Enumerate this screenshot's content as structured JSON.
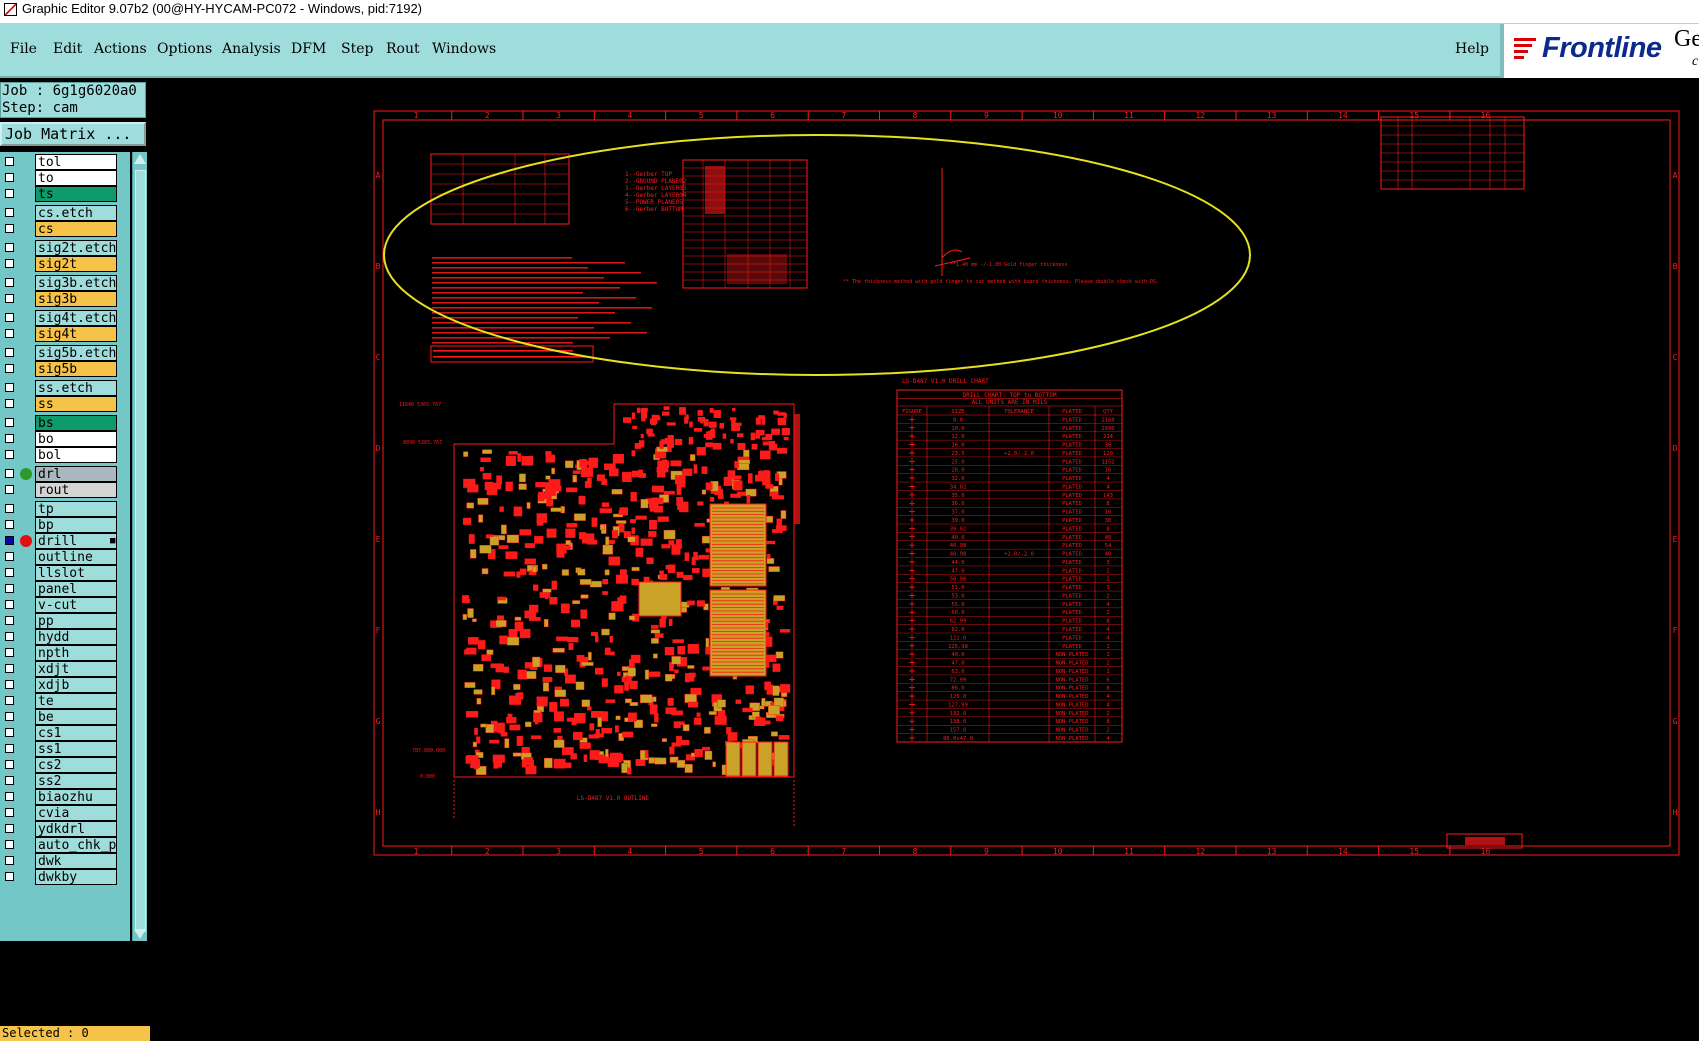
{
  "window": {
    "title": "Graphic Editor 9.07b2 (00@HY-HYCAM-PC072 - Windows, pid:7192)"
  },
  "menu": {
    "items": [
      "File",
      "Edit",
      "Actions",
      "Options",
      "Analysis",
      "DFM",
      "Step",
      "Rout",
      "Windows"
    ],
    "help": "Help"
  },
  "logo": {
    "brand": "Frontline",
    "ge": "Ge",
    "sub": "c"
  },
  "job": {
    "job_line": "Job : 6g1g6020a0",
    "step_line": "Step: cam",
    "matrix_button": "Job Matrix ..."
  },
  "layers": [
    {
      "name": "tol",
      "color": "#ffffff"
    },
    {
      "name": "to",
      "color": "#ffffff"
    },
    {
      "name": "ts",
      "color": "#0f9a6c"
    },
    {
      "name": "cs.etch",
      "color": "#9fdcdc"
    },
    {
      "name": "cs",
      "color": "#f5c24a"
    },
    {
      "name": "sig2t.etch",
      "color": "#9fdcdc"
    },
    {
      "name": "sig2t",
      "color": "#f5c24a"
    },
    {
      "name": "sig3b.etch",
      "color": "#9fdcdc"
    },
    {
      "name": "sig3b",
      "color": "#f5c24a"
    },
    {
      "name": "sig4t.etch",
      "color": "#9fdcdc"
    },
    {
      "name": "sig4t",
      "color": "#f5c24a"
    },
    {
      "name": "sig5b.etch",
      "color": "#9fdcdc"
    },
    {
      "name": "sig5b",
      "color": "#f5c24a"
    },
    {
      "name": "ss.etch",
      "color": "#9fdcdc"
    },
    {
      "name": "ss",
      "color": "#f5c24a"
    },
    {
      "name": "bs",
      "color": "#0f9a6c"
    },
    {
      "name": "bo",
      "color": "#ffffff"
    },
    {
      "name": "bol",
      "color": "#ffffff"
    },
    {
      "name": "drl",
      "color": "#a9b7bf"
    },
    {
      "name": "rout",
      "color": "#d4d4d4"
    },
    {
      "name": "tp",
      "color": "#9fdcdc"
    },
    {
      "name": "bp",
      "color": "#9fdcdc"
    },
    {
      "name": "drill",
      "color": "#9fdcdc"
    },
    {
      "name": "outline",
      "color": "#9fdcdc"
    },
    {
      "name": "llslot",
      "color": "#9fdcdc"
    },
    {
      "name": "panel",
      "color": "#9fdcdc"
    },
    {
      "name": "v-cut",
      "color": "#9fdcdc"
    },
    {
      "name": "pp",
      "color": "#9fdcdc"
    },
    {
      "name": "hydd",
      "color": "#9fdcdc"
    },
    {
      "name": "npth",
      "color": "#9fdcdc"
    },
    {
      "name": "xdjt",
      "color": "#9fdcdc"
    },
    {
      "name": "xdjb",
      "color": "#9fdcdc"
    },
    {
      "name": "te",
      "color": "#9fdcdc"
    },
    {
      "name": "be",
      "color": "#9fdcdc"
    },
    {
      "name": "cs1",
      "color": "#9fdcdc"
    },
    {
      "name": "ss1",
      "color": "#9fdcdc"
    },
    {
      "name": "cs2",
      "color": "#9fdcdc"
    },
    {
      "name": "ss2",
      "color": "#9fdcdc"
    },
    {
      "name": "biaozhu",
      "color": "#9fdcdc"
    },
    {
      "name": "cvia",
      "color": "#9fdcdc"
    },
    {
      "name": "ydkdrl",
      "color": "#9fdcdc"
    },
    {
      "name": "auto_chk_pn",
      "color": "#9fdcdc"
    },
    {
      "name": "dwk",
      "color": "#9fdcdc"
    },
    {
      "name": "dwkby",
      "color": "#9fdcdc"
    }
  ],
  "status": {
    "selected": "Selected : 0"
  },
  "drawing": {
    "col_labels": [
      "1",
      "2",
      "3",
      "4",
      "5",
      "6",
      "7",
      "8",
      "9",
      "10",
      "11",
      "12",
      "13",
      "14",
      "15",
      "16"
    ],
    "row_labels": [
      "A",
      "B",
      "C",
      "D",
      "E",
      "F",
      "G",
      "H"
    ],
    "layer_list": [
      "1--Gerber TOP",
      "2--GROUND PLANE02",
      "3--Gerber LAYER03",
      "4--Gerber LAYER04",
      "5--POWER PLANE05",
      "6--Gerber BOTTOM"
    ],
    "drill_chart_heading": "LS-D487 V1.0 DRILL CHART",
    "drill_title": "DRILL CHART: TOP to BOTTOM",
    "drill_subtitle": "ALL UNITS ARE IN MILS",
    "drill_columns": [
      "FIGURE",
      "SIZE",
      "TOLERANCE",
      "PLATED",
      "QTY"
    ],
    "drill_rows": [
      {
        "size": "8.0",
        "tol": "",
        "plated": "PLATED",
        "qty": "2168"
      },
      {
        "size": "10.0",
        "tol": "",
        "plated": "PLATED",
        "qty": "2990"
      },
      {
        "size": "12.0",
        "tol": "",
        "plated": "PLATED",
        "qty": "214"
      },
      {
        "size": "16.0",
        "tol": "",
        "plated": "PLATED",
        "qty": "30"
      },
      {
        "size": "23.5",
        "tol": "+2.0/-2.0",
        "plated": "PLATED",
        "qty": "120"
      },
      {
        "size": "25.0",
        "tol": "",
        "plated": "PLATED",
        "qty": "1152"
      },
      {
        "size": "28.0",
        "tol": "",
        "plated": "PLATED",
        "qty": "16"
      },
      {
        "size": "32.0",
        "tol": "",
        "plated": "PLATED",
        "qty": "4"
      },
      {
        "size": "34.02",
        "tol": "",
        "plated": "PLATED",
        "qty": "4"
      },
      {
        "size": "35.0",
        "tol": "",
        "plated": "PLATED",
        "qty": "143"
      },
      {
        "size": "36.0",
        "tol": "",
        "plated": "PLATED",
        "qty": "8"
      },
      {
        "size": "37.0",
        "tol": "",
        "plated": "PLATED",
        "qty": "16"
      },
      {
        "size": "39.0",
        "tol": "",
        "plated": "PLATED",
        "qty": "38"
      },
      {
        "size": "39.02",
        "tol": "",
        "plated": "PLATED",
        "qty": "8"
      },
      {
        "size": "40.0",
        "tol": "",
        "plated": "PLATED",
        "qty": "40"
      },
      {
        "size": "40.98",
        "tol": "",
        "plated": "PLATED",
        "qty": "54"
      },
      {
        "size": "40.98",
        "tol": "+2.0/-2.0",
        "plated": "PLATED",
        "qty": "40"
      },
      {
        "size": "44.0",
        "tol": "",
        "plated": "PLATED",
        "qty": "3"
      },
      {
        "size": "47.0",
        "tol": "",
        "plated": "PLATED",
        "qty": "2"
      },
      {
        "size": "50.98",
        "tol": "",
        "plated": "PLATED",
        "qty": "2"
      },
      {
        "size": "51.0",
        "tol": "",
        "plated": "PLATED",
        "qty": "3"
      },
      {
        "size": "53.0",
        "tol": "",
        "plated": "PLATED",
        "qty": "2"
      },
      {
        "size": "55.0",
        "tol": "",
        "plated": "PLATED",
        "qty": "4"
      },
      {
        "size": "60.0",
        "tol": "",
        "plated": "PLATED",
        "qty": "2"
      },
      {
        "size": "62.99",
        "tol": "",
        "plated": "PLATED",
        "qty": "8"
      },
      {
        "size": "82.0",
        "tol": "",
        "plated": "PLATED",
        "qty": "4"
      },
      {
        "size": "122.0",
        "tol": "",
        "plated": "PLATED",
        "qty": "4"
      },
      {
        "size": "125.98",
        "tol": "",
        "plated": "PLATED",
        "qty": "1"
      },
      {
        "size": "40.0",
        "tol": "",
        "plated": "NON-PLATED",
        "qty": "1"
      },
      {
        "size": "47.0",
        "tol": "",
        "plated": "NON-PLATED",
        "qty": "2"
      },
      {
        "size": "63.0",
        "tol": "",
        "plated": "NON-PLATED",
        "qty": "1"
      },
      {
        "size": "72.99",
        "tol": "",
        "plated": "NON-PLATED",
        "qty": "6"
      },
      {
        "size": "86.0",
        "tol": "",
        "plated": "NON-PLATED",
        "qty": "8"
      },
      {
        "size": "126.0",
        "tol": "",
        "plated": "NON-PLATED",
        "qty": "4"
      },
      {
        "size": "127.99",
        "tol": "",
        "plated": "NON-PLATED",
        "qty": "4"
      },
      {
        "size": "132.0",
        "tol": "",
        "plated": "NON-PLATED",
        "qty": "2"
      },
      {
        "size": "138.0",
        "tol": "",
        "plated": "NON-PLATED",
        "qty": "8"
      },
      {
        "size": "157.0",
        "tol": "",
        "plated": "NON-PLATED",
        "qty": "2"
      },
      {
        "size": "86.0x47.0",
        "tol": "",
        "plated": "NON-PLATED",
        "qty": "4"
      }
    ],
    "outline_label": "LS-D487 V1.0 OUTLINE",
    "fingers_note": "**1.40 mm -/-1.00 Gold finger thickness",
    "fingers_caption": "** The thickness method with gold finger to cut method with board thickness, Please double check with DS.",
    "dim_labels": [
      "11640 5365.767",
      "8890 5365.767",
      "787.000.000",
      "0.000"
    ],
    "colors": {
      "drawing_red": "#ff1a1a",
      "copper_yellow": "#c9a227",
      "highlight_ellipse": "#e6e020",
      "panel_teal": "#9fdcdc"
    }
  }
}
